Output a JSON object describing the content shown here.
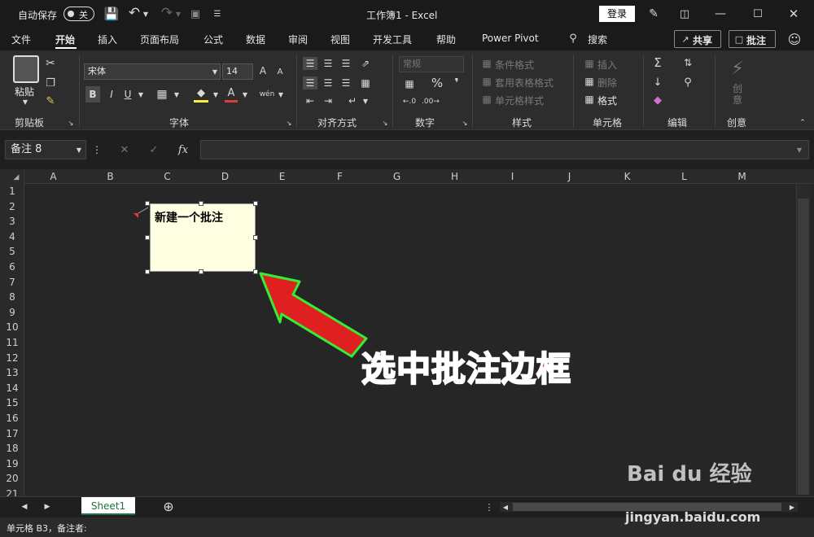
{
  "titlebar": {
    "autosave_label": "自动保存",
    "autosave_state": "关",
    "doc_title": "工作簿1  -  Excel",
    "login_label": "登录"
  },
  "tabs": [
    "文件",
    "开始",
    "插入",
    "页面布局",
    "公式",
    "数据",
    "审阅",
    "视图",
    "开发工具",
    "帮助",
    "Power Pivot"
  ],
  "search_label": "搜索",
  "share_label": "共享",
  "comment_btn_label": "批注",
  "ribbon": {
    "paste_label": "粘贴",
    "clipboard_group": "剪贴板",
    "font_name": "宋体",
    "font_size": "14",
    "font_group": "字体",
    "bold": "B",
    "italic": "I",
    "underline": "U",
    "align_group": "对齐方式",
    "number_format": "常规",
    "number_group": "数字",
    "cond_format": "条件格式",
    "table_format": "套用表格格式",
    "cell_style": "单元格样式",
    "style_group": "样式",
    "insert_label": "插入",
    "delete_label": "删除",
    "format_label": "格式",
    "cells_group": "单元格",
    "edit_group": "编辑",
    "idea_label": "创意",
    "idea_group": "创意",
    "percent": "%",
    "wen": "wén",
    "font_a": "A"
  },
  "formula_bar": {
    "name_box": "备注 8",
    "fx": "fx",
    "cancel": "✕",
    "enter": "✓"
  },
  "columns": [
    "A",
    "B",
    "C",
    "D",
    "E",
    "F",
    "G",
    "H",
    "I",
    "J",
    "K",
    "L",
    "M"
  ],
  "rows": [
    "1",
    "2",
    "3",
    "4",
    "5",
    "6",
    "7",
    "8",
    "9",
    "10",
    "11",
    "12",
    "13",
    "14",
    "15",
    "16",
    "17",
    "18",
    "19",
    "20",
    "21"
  ],
  "comment_text": "新建一个批注",
  "annotation_text": "选中批注边框",
  "sheet_tab": "Sheet1",
  "status_text": "单元格 B3，备注者:",
  "watermark": {
    "logo": "Bai du 经验",
    "url": "jingyan.baidu.com"
  }
}
